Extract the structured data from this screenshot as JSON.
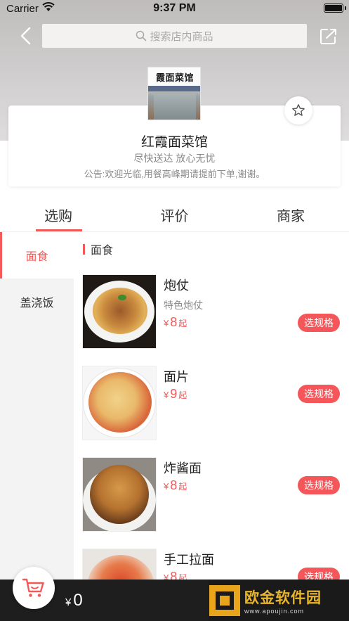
{
  "status_bar": {
    "carrier": "Carrier",
    "time": "9:37 PM"
  },
  "header": {
    "search_placeholder": "搜索店内商品"
  },
  "shop": {
    "logo_text": "霞面菜馆",
    "name": "红霞面菜馆",
    "tagline": "尽快送达  放心无忧",
    "notice": "公告:欢迎光临,用餐高峰期请提前下单,谢谢。"
  },
  "tabs": [
    {
      "label": "选购",
      "active": true
    },
    {
      "label": "评价",
      "active": false
    },
    {
      "label": "商家",
      "active": false
    }
  ],
  "categories": [
    {
      "label": "面食",
      "active": true
    },
    {
      "label": "盖浇饭",
      "active": false
    }
  ],
  "section": {
    "title": "面食"
  },
  "products": [
    {
      "name": "炮仗",
      "desc": "特色炮仗",
      "currency": "¥",
      "price": "8",
      "unit": "起",
      "button": "选规格"
    },
    {
      "name": "面片",
      "desc": "",
      "currency": "¥",
      "price": "9",
      "unit": "起",
      "button": "选规格"
    },
    {
      "name": "炸酱面",
      "desc": "",
      "currency": "¥",
      "price": "8",
      "unit": "起",
      "button": "选规格"
    },
    {
      "name": "手工拉面",
      "desc": "",
      "currency": "¥",
      "price": "8",
      "unit": "起",
      "button": "选规格"
    }
  ],
  "cart": {
    "currency": "¥",
    "total": "0"
  },
  "watermark": {
    "main": "欧金软件园",
    "sub": "www.apoujin.com"
  },
  "colors": {
    "accent": "#f25a5a",
    "cart_bar": "#1e1e1e",
    "watermark": "#e9b52a"
  },
  "icons": [
    "wifi-icon",
    "back-icon",
    "search-icon",
    "share-icon",
    "star-icon",
    "cart-icon"
  ]
}
